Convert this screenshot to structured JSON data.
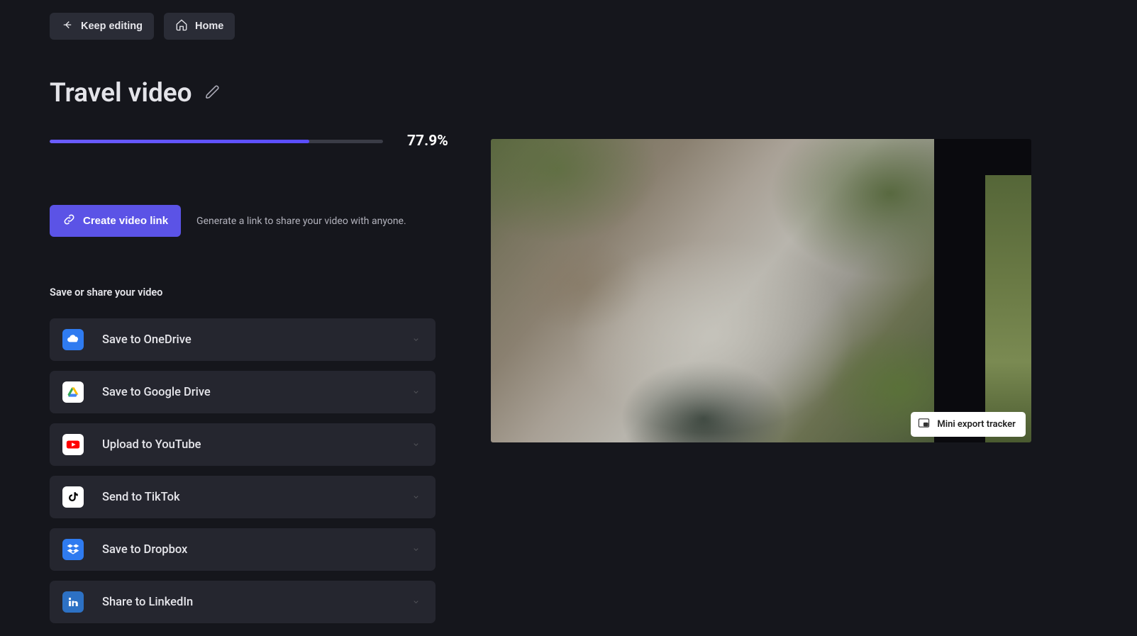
{
  "header": {
    "keep_editing_label": "Keep editing",
    "home_label": "Home"
  },
  "project": {
    "title": "Travel video"
  },
  "progress": {
    "percent": 77.9,
    "display": "77.9%"
  },
  "share_link": {
    "button_label": "Create video link",
    "description": "Generate a link to share your video with anyone."
  },
  "share_section": {
    "heading": "Save or share your video",
    "options": [
      {
        "id": "onedrive",
        "label": "Save to OneDrive",
        "bg": "#2f7bf0",
        "fg": "#ffffff",
        "glyph": "onedrive"
      },
      {
        "id": "googledrive",
        "label": "Save to Google Drive",
        "bg": "#ffffff",
        "fg": "#000000",
        "glyph": "gdrive"
      },
      {
        "id": "youtube",
        "label": "Upload to YouTube",
        "bg": "#ffffff",
        "fg": "#ff0000",
        "glyph": "youtube"
      },
      {
        "id": "tiktok",
        "label": "Send to TikTok",
        "bg": "#ffffff",
        "fg": "#000000",
        "glyph": "tiktok"
      },
      {
        "id": "dropbox",
        "label": "Save to Dropbox",
        "bg": "#2f7bf0",
        "fg": "#ffffff",
        "glyph": "dropbox"
      },
      {
        "id": "linkedin",
        "label": "Share to LinkedIn",
        "bg": "#2d71c4",
        "fg": "#ffffff",
        "glyph": "linkedin"
      }
    ]
  },
  "tracker": {
    "label": "Mini export tracker"
  }
}
